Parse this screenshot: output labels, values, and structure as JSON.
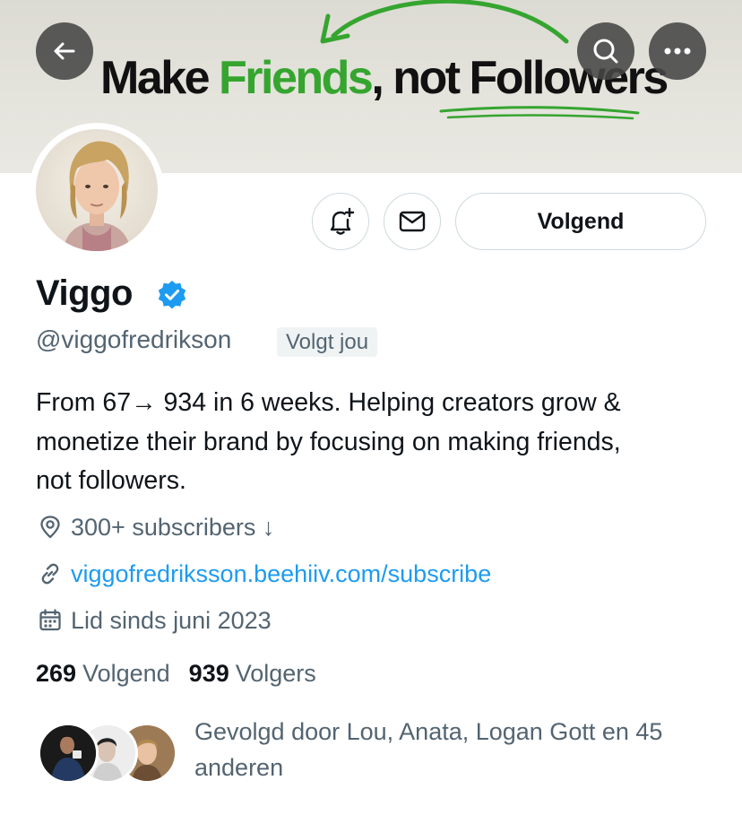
{
  "banner": {
    "text_part1": "Make ",
    "text_green": "Friends",
    "text_part2": ", not Followers",
    "accent_color": "#35a52f"
  },
  "topbar": {
    "back_icon": "arrow-left-icon",
    "search_icon": "search-icon",
    "more_icon": "more-horizontal-icon"
  },
  "actions": {
    "notify_icon": "bell-plus-icon",
    "message_icon": "envelope-icon",
    "follow_label": "Volgend"
  },
  "profile": {
    "name": "Viggo",
    "verified_icon": "verified-badge-icon",
    "verified_color": "#1d9bf0",
    "handle": "@viggofredrikson",
    "follows_you": "Volgt jou",
    "bio_line1": "From 67→ 934 in 6 weeks. Helping creators grow &",
    "bio_line2": "monetize their brand by focusing on making friends,",
    "bio_line3": "not followers.",
    "location": "300+ subscribers ↓",
    "link": "viggofredriksson.beehiiv.com/subscribe",
    "joined": "Lid sinds juni 2023"
  },
  "stats": {
    "following_count": "269",
    "following_label": "Volgend",
    "followers_count": "939",
    "followers_label": "Volgers"
  },
  "followed_by": {
    "line1": "Gevolgd door Lou, Anata, Logan Gott en 45",
    "line2": "anderen"
  }
}
